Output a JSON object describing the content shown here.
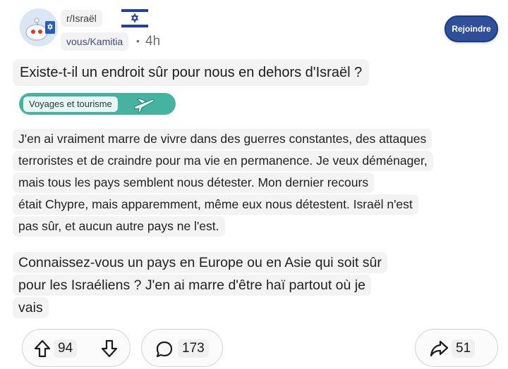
{
  "post": {
    "subreddit": "r/Israël",
    "author": "vous/Kamitia",
    "separator": "•",
    "age": "4h",
    "join_label": "Rejoindre",
    "title": "Existe-t-il un endroit sûr pour nous en dehors d'Israël ?",
    "flair": "Voyages et tourisme",
    "body_paragraph_1": [
      "J'en ai vraiment marre de vivre dans des guerres constantes, des attaques",
      "terroristes et de craindre pour ma vie en permanence. Je veux déménager,",
      "mais tous les pays semblent nous détester. Mon dernier recours",
      "était Chypre, mais apparemment, même eux nous détestent. Israël n'est",
      "pas sûr, et aucun autre pays ne l'est."
    ],
    "body_paragraph_2": [
      "Connaissez-vous un pays en Europe ou en Asie qui soit sûr",
      "pour les Israéliens ? J'en ai marre d'être haï partout où je",
      "vais"
    ]
  },
  "actions": {
    "upvotes": "94",
    "comments": "173",
    "shares": "51"
  },
  "icons": {
    "avatar": "snoo-avatar-icon",
    "flag": "israel-flag-icon",
    "flair": "airplane-icon",
    "upvote": "arrow-up-icon",
    "downvote": "arrow-down-icon",
    "comment": "comment-bubble-icon",
    "share": "share-arrow-icon"
  },
  "colors": {
    "join_button": "#2f4f9a",
    "flair_background": "#46b3a0",
    "flag_blue": "#1f3fa8"
  }
}
